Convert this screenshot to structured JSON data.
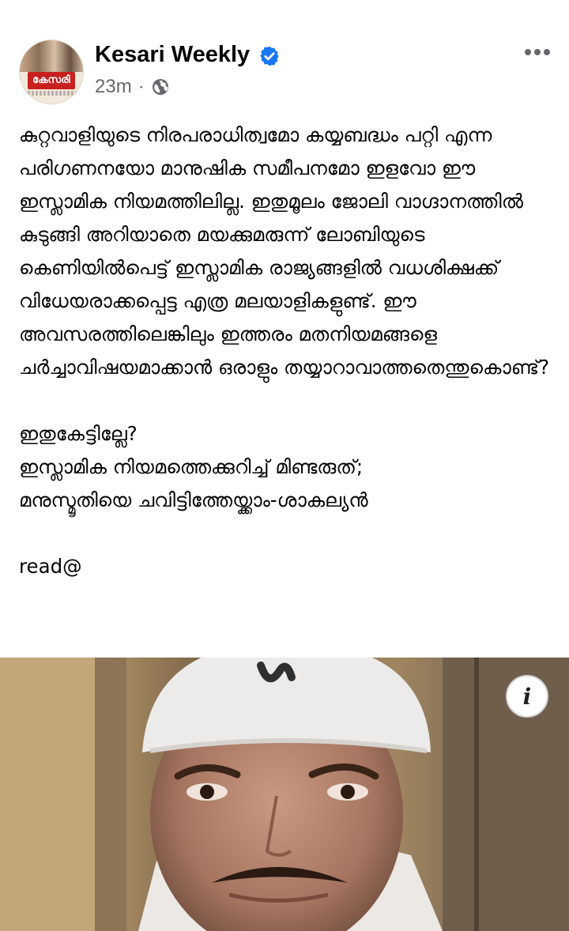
{
  "post": {
    "page_name": "Kesari Weekly",
    "timestamp": "23m",
    "separator": "·",
    "avatar_logo_text": "കേസരി",
    "privacy_icon": "globe-icon",
    "verified_icon": "verified-badge-icon",
    "more_icon": "more-dots-icon",
    "text": {
      "paragraph_1": "കുറ്റവാളിയുടെ നിരപരാധിത്വമോ കയ്യബദ്ധം പറ്റി എന്ന പരിഗണനയോ മാനുഷിക സമീപനമോ ഇളവോ ഈ ഇസ്ലാമിക നിയമത്തിലില്ല. ഇതുമൂലം ജോലി വാഗ്ദാനത്തിൽ കുടുങ്ങി അറിയാതെ മയക്കുമരുന്ന് ലോബിയുടെ കെണിയിൽപെട്ട് ഇസ്ലാമിക രാജ്യങ്ങളിൽ വധശിക്ഷക്ക് വിധേയരാക്കപ്പെട്ട എത്ര മലയാളികളുണ്ട്. ഈ അവസരത്തിലെങ്കിലും ഇത്തരം മതനിയമങ്ങളെ ചർച്ചാവിഷയമാക്കാൻ ഒരാളും തയ്യാറാവാത്തതെന്തുകൊണ്ട്?",
      "line_2": "ഇതുകേട്ടില്ലേ?",
      "line_3": "ഇസ്ലാമിക നിയമത്തെക്കുറിച്ച് മിണ്ടരുത്;",
      "line_4": "മനുസ്മൃതിയെ ചവിട്ടിത്തേയ്ക്കാം-ശാകല്യൻ",
      "line_5": "read@"
    },
    "media": {
      "info_label": "i",
      "info_icon": "info-icon"
    }
  },
  "colors": {
    "text_primary": "#050505",
    "text_secondary": "#65676b",
    "verified_blue": "#1877f2",
    "logo_red": "#c8201f"
  }
}
